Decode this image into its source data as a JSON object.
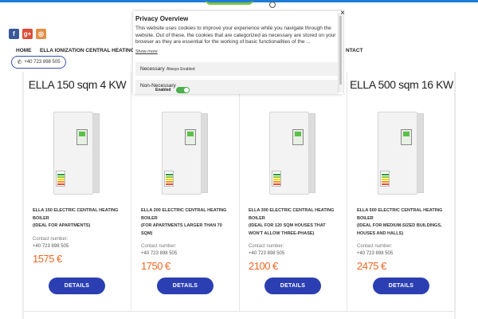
{
  "header": {
    "social": [
      {
        "icon": "facebook-icon",
        "glyph": "f"
      },
      {
        "icon": "google-plus-icon",
        "glyph": "g+"
      },
      {
        "icon": "instagram-icon",
        "glyph": "◎"
      }
    ],
    "nav": {
      "home": "HOME",
      "ionization": "ELLA IONIZATION CENTRAL HEATING BO",
      "contact": "NTACT"
    },
    "phone": "+40 723 898 505"
  },
  "products": [
    {
      "title": "ELLA 150 sqm 4 KW",
      "desc": [
        "ELLA 150 ELECTRIC CENTRAL HEATING",
        "BOILER",
        "(IDEAL FOR APARTMENTS)"
      ],
      "contact_label": "Contact number:",
      "contact_number": "+40 723 898 505",
      "price": "1575 €",
      "button": "DETAILS"
    },
    {
      "title": "",
      "desc": [
        "ELLA 200 ELECTRIC CENTRAL HEATING",
        "BOILER",
        "(FOR APARTMENTS LARGER THAN 70",
        "SQM)"
      ],
      "contact_label": "Contact number:",
      "contact_number": "+40 723 898 505",
      "price": "1750 €",
      "button": "DETAILS"
    },
    {
      "title": "",
      "desc": [
        "ELLA 300 ELECTRIC CENTRAL HEATING",
        "BOILER",
        "(IDEAL FOR 120 SQM HOUSES THAT",
        "WON'T ALLOW THREE-PHASE)"
      ],
      "contact_label": "Contact number:",
      "contact_number": "+40 723 898 505",
      "price": "2100 €",
      "button": "DETAILS"
    },
    {
      "title": "ELLA 500 sqm 16 KW",
      "desc": [
        "ELLA 500 ELECTRIC CENTRAL HEATING",
        "BOILER",
        "(IDEAL FOR MEDIUM-SIZED BUILDINGS,",
        "HOUSES AND HALLS)"
      ],
      "contact_label": "Contact number:",
      "contact_number": "+40 723 898 505",
      "price": "2475 €",
      "button": "DETAILS"
    }
  ],
  "privacy": {
    "title": "Privacy Overview",
    "text": "This website uses cookies to improve your experience while you navigate through the website. Out of these, the cookies that are categorized as necessary are stored on your browser as they are essential for the working of basic functionalities of the ...",
    "show_more": "Show more",
    "necessary_label": "Necessary",
    "necessary_status": "Always Enabled",
    "non_necessary_label": "Non-Necessary",
    "non_necessary_status": "Enabled",
    "close_glyph": "×"
  },
  "colors": {
    "accent": "#2b3fb3",
    "price": "#f26522",
    "toggle": "#4caf50"
  }
}
